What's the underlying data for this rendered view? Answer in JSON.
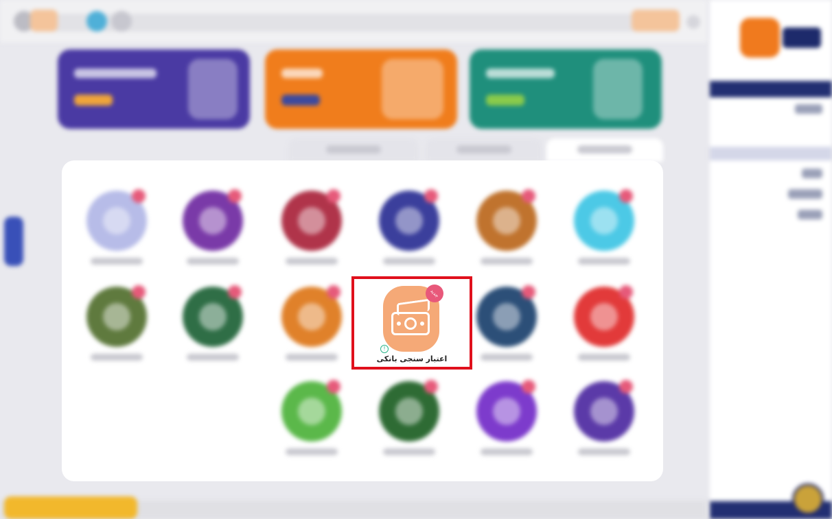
{
  "apps": {
    "highlighted": {
      "label": "اعتبار سنجی بانکی",
      "badge": "جدید",
      "info_glyph": "!",
      "icon": "banknote-icon",
      "color": "#f5a977"
    },
    "tile_colors": [
      "#b7bce8",
      "#7a3aa8",
      "#b0344a",
      "#3b3f9c",
      "#c0732e",
      "#4cc9e6",
      "#5f7a3e",
      "#2f6e46",
      "#e0812a",
      "#2c4f78",
      "#e23a3a",
      "#5bb84a",
      "#2e6b34",
      "#7d3bcc",
      "#5b3aa8"
    ]
  },
  "banners": [
    {
      "color": "#4a3aa3",
      "accent": "#f0a53a"
    },
    {
      "color": "#f07d1c",
      "accent": "#3d4a9e"
    },
    {
      "color": "#1f8f7c",
      "accent": "#8acb4b"
    }
  ],
  "sidebar": {
    "brand_color": "#222f72",
    "logo_color": "#f07a1e"
  },
  "highlight_color": "#e0101c"
}
